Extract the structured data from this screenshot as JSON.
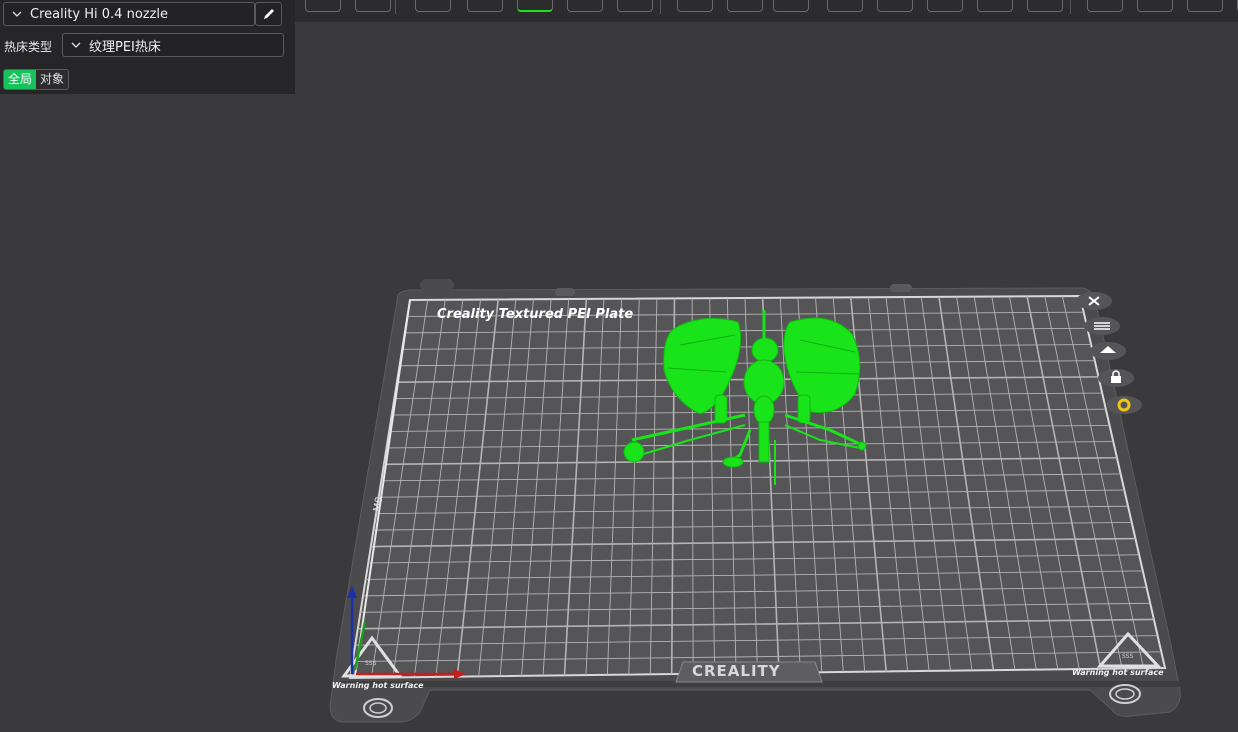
{
  "left_panel": {
    "printer": {
      "value": "Creality Hi 0.4 nozzle"
    },
    "bed_type": {
      "label": "热床类型",
      "value": "纹理PEI热床"
    },
    "scope": {
      "global_label": "全局",
      "object_label": "对象",
      "selected": "global"
    }
  },
  "toolbar": {
    "icons": [
      "cube-view-icon",
      "keyboard-icon",
      "add-shape-icon",
      "add-plate-icon",
      "auto-orient-icon",
      "arrange-icon",
      "split-icon",
      "move-icon",
      "rotate-icon",
      "scale-icon",
      "cut-icon",
      "support-paint-icon",
      "seam-paint-icon",
      "color-paint-icon",
      "measure-icon",
      "assembly-icon",
      "variable-layer-icon",
      "text-icon",
      "view-icon"
    ]
  },
  "build_plate": {
    "title": "Creality Textured PEI Plate",
    "brand": "CREALITY",
    "warning_left": "Warning hot surface",
    "warning_right": "Warning hot surface",
    "triangle_code": "SSS",
    "colors": {
      "model": "#19e319",
      "plate": "#4b4b4d",
      "grid_bg": "#555557",
      "grid_line": "#aaaaaa"
    }
  },
  "plate_controls": [
    "close-icon",
    "list-icon",
    "auto-arrange-icon",
    "lock-icon",
    "settings-icon"
  ]
}
